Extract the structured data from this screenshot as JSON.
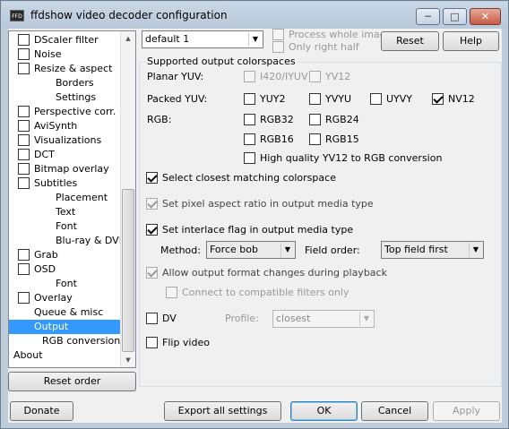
{
  "window": {
    "title": "ffdshow video decoder configuration",
    "icon_text": "FFD",
    "controls": {
      "minimize": "─",
      "maximize": "□",
      "close": "✕"
    }
  },
  "tree": {
    "items": [
      {
        "label": "DScaler filter",
        "checkbox": true,
        "checked": false,
        "indent": 0
      },
      {
        "label": "Noise",
        "checkbox": true,
        "checked": false,
        "indent": 0
      },
      {
        "label": "Resize & aspect",
        "checkbox": true,
        "checked": false,
        "indent": 0
      },
      {
        "label": "Borders",
        "checkbox": false,
        "indent": 1
      },
      {
        "label": "Settings",
        "checkbox": false,
        "indent": 1
      },
      {
        "label": "Perspective corr.",
        "checkbox": true,
        "checked": false,
        "indent": 0
      },
      {
        "label": "AviSynth",
        "checkbox": true,
        "checked": false,
        "indent": 0
      },
      {
        "label": "Visualizations",
        "checkbox": true,
        "checked": false,
        "indent": 0
      },
      {
        "label": "DCT",
        "checkbox": true,
        "checked": false,
        "indent": 0
      },
      {
        "label": "Bitmap overlay",
        "checkbox": true,
        "checked": false,
        "indent": 0
      },
      {
        "label": "Subtitles",
        "checkbox": true,
        "checked": false,
        "indent": 0
      },
      {
        "label": "Placement",
        "checkbox": false,
        "indent": 1
      },
      {
        "label": "Text",
        "checkbox": false,
        "indent": 1
      },
      {
        "label": "Font",
        "checkbox": false,
        "indent": 1
      },
      {
        "label": "Blu-ray & DVD",
        "checkbox": false,
        "indent": 1
      },
      {
        "label": "Grab",
        "checkbox": true,
        "checked": false,
        "indent": 0
      },
      {
        "label": "OSD",
        "checkbox": true,
        "checked": false,
        "indent": 0
      },
      {
        "label": "Font",
        "checkbox": false,
        "indent": 1
      },
      {
        "label": "Overlay",
        "checkbox": true,
        "checked": false,
        "indent": 0
      },
      {
        "label": "Queue & misc",
        "checkbox": false,
        "indent": 0
      },
      {
        "label": "Output",
        "checkbox": false,
        "indent": 0,
        "selected": true
      },
      {
        "label": "RGB conversion",
        "checkbox": false,
        "indent": 2
      },
      {
        "label": "About",
        "checkbox": false,
        "indent": -1
      }
    ],
    "reset_order": "Reset order"
  },
  "top": {
    "preset": "default 1",
    "process_whole_image": "Process whole image",
    "only_right_half": "Only right half",
    "reset": "Reset",
    "help": "Help"
  },
  "colorspaces": {
    "group_title": "Supported output colorspaces",
    "planar_label": "Planar YUV:",
    "packed_label": "Packed YUV:",
    "rgb_label": "RGB:",
    "i420": "I420/IYUV",
    "yv12": "YV12",
    "yuy2": "YUY2",
    "yvyu": "YVYU",
    "uyvy": "UYVY",
    "nv12": "NV12",
    "rgb32": "RGB32",
    "rgb24": "RGB24",
    "rgb16": "RGB16",
    "rgb15": "RGB15",
    "hq_yv12": "High quality YV12 to RGB conversion"
  },
  "options": {
    "closest_colorspace": "Select closest matching colorspace",
    "pixel_aspect": "Set pixel aspect ratio in output media type",
    "interlace_flag": "Set interlace flag in output media type",
    "method_label": "Method:",
    "method_value": "Force bob",
    "field_order_label": "Field order:",
    "field_order_value": "Top field first",
    "allow_format_changes": "Allow output format changes during playback",
    "connect_compatible": "Connect to compatible filters only",
    "dv": "DV",
    "profile_label": "Profile:",
    "profile_value": "closest",
    "flip_video": "Flip video"
  },
  "bottom": {
    "donate": "Donate",
    "export": "Export all settings",
    "ok": "OK",
    "cancel": "Cancel",
    "apply": "Apply"
  }
}
